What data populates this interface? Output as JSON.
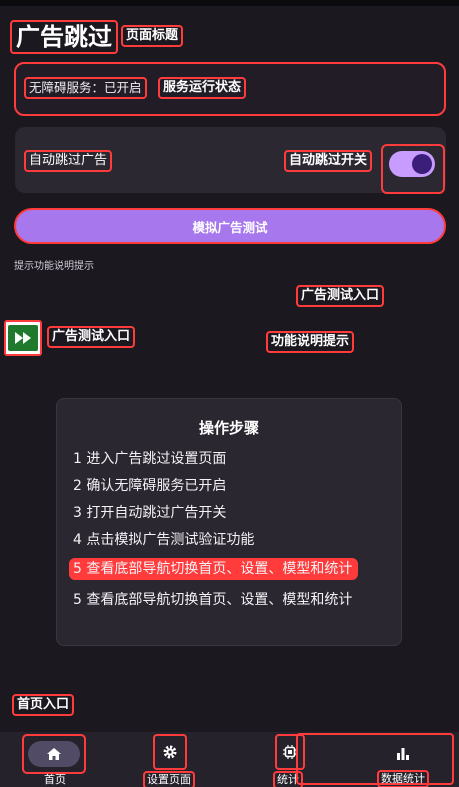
{
  "page": {
    "title": "广告跳过",
    "title_annotation": "页面标题"
  },
  "status": {
    "text": "无障碍服务：已开启",
    "annotation": "服务运行状态"
  },
  "auto_skip": {
    "label": "自动跳过广告",
    "annotation": "自动跳过开关",
    "enabled": true
  },
  "test_button": {
    "label": "模拟广告测试"
  },
  "hint": {
    "text": "提示功能说明提示",
    "annotation": "功能说明提示"
  },
  "ad_test_entry": {
    "annotation_top": "广告测试入口",
    "annotation_side": "广告测试入口",
    "icon": "fast-forward-icon"
  },
  "steps": {
    "title": "操作步骤",
    "items": [
      "1  进入广告跳过设置页面",
      "2  确认无障碍服务已开启",
      "3  打开自动跳过广告开关",
      "4  点击模拟广告测试验证功能",
      "5  查看底部导航切换首页、设置、模型和统计",
      "5  查看底部导航切换首页、设置、模型和统计"
    ]
  },
  "home_entry": {
    "annotation": "首页入口"
  },
  "bottom_nav": {
    "home": "首页",
    "settings": "设置页面",
    "model": "统计",
    "stats": "数据统计"
  },
  "colors": {
    "background": "#1c1820",
    "accent": "#a777ee",
    "toggle_on": "#c89cff",
    "annotation": "#ff3b3b"
  }
}
